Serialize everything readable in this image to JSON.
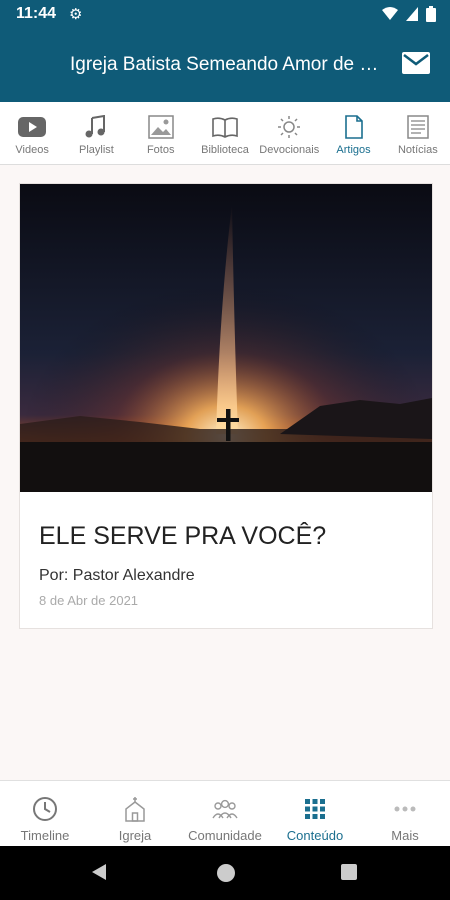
{
  "status": {
    "time": "11:44"
  },
  "header": {
    "title": "Igreja Batista Semeando Amor de Deus"
  },
  "tabs": [
    {
      "label": "Videos",
      "icon": "youtube-icon"
    },
    {
      "label": "Playlist",
      "icon": "music-note-icon"
    },
    {
      "label": "Fotos",
      "icon": "photos-icon"
    },
    {
      "label": "Biblioteca",
      "icon": "book-icon"
    },
    {
      "label": "Devocionais",
      "icon": "sun-icon"
    },
    {
      "label": "Artigos",
      "icon": "document-icon",
      "active": true
    },
    {
      "label": "Notícias",
      "icon": "newspaper-icon"
    }
  ],
  "article": {
    "title": "ELE SERVE PRA VOCÊ?",
    "author": "Por: Pastor Alexandre",
    "date": "8 de Abr de 2021"
  },
  "bottom_nav": [
    {
      "label": "Timeline",
      "icon": "clock-icon"
    },
    {
      "label": "Igreja",
      "icon": "church-icon"
    },
    {
      "label": "Comunidade",
      "icon": "people-icon"
    },
    {
      "label": "Conteúdo",
      "icon": "grid-icon",
      "active": true
    },
    {
      "label": "Mais",
      "icon": "more-dots-icon"
    }
  ],
  "colors": {
    "primary": "#0f5b78",
    "accent": "#1b6f8f",
    "background": "#fbf7f6"
  }
}
